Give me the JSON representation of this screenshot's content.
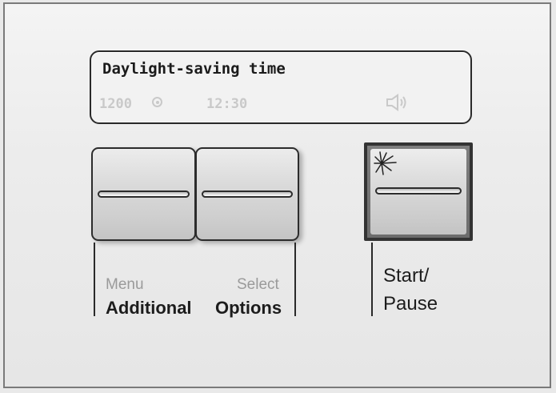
{
  "display": {
    "title": "Daylight-saving time",
    "ghost_rpm": "1200",
    "ghost_time": "12:30"
  },
  "buttons": {
    "additional_menu": {
      "top_label": "Menu",
      "label": "Additional"
    },
    "select_options": {
      "top_label": "Select",
      "label": "Options"
    },
    "start_pause": {
      "label_line1": "Start/",
      "label_line2": "Pause"
    }
  },
  "icons": {
    "rpm": "spin-speed-icon",
    "speaker": "speaker-icon",
    "indicator": "sparkle-indicator-icon"
  },
  "colors": {
    "panel": "#ececec",
    "display_text": "#1b1b1b",
    "inactive_segment": "#c9c9c9",
    "outline": "#2c2c2c"
  }
}
